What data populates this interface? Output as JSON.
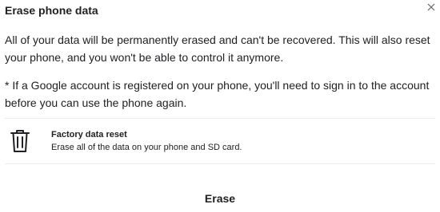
{
  "dialog": {
    "title": "Erase phone data",
    "close_icon": "close-icon",
    "message": "All of your data will be permanently erased and can't be recovered. This will also reset your phone, and you won't be able to control it anymore.",
    "note": "* If a Google account is registered on your phone, you'll need to sign in to the account before you can use the phone again.",
    "option": {
      "icon": "trash-icon",
      "title": "Factory data reset",
      "description": "Erase all of the data on your phone and SD card."
    },
    "erase_label": "Erase"
  },
  "colors": {
    "text": "#202124",
    "divider": "#ececec",
    "background": "#ffffff"
  }
}
